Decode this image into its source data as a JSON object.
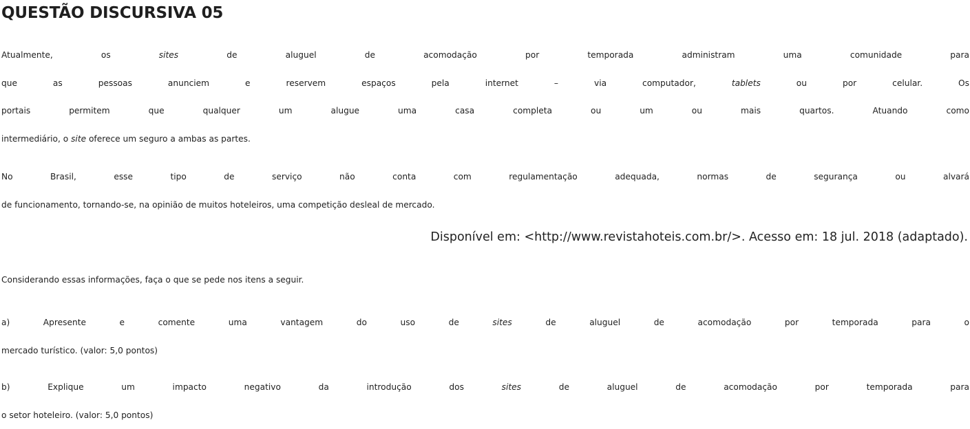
{
  "title": "QUESTÃO DISCURSIVA 05",
  "paragraph1": {
    "line1_a": "Atualmente, os ",
    "line1_b": "sites",
    "line1_c": " de aluguel de acomodação por temporada administram uma comunidade para",
    "line2_a": "que as pessoas anunciem e reservem espaços pela internet – via computador, ",
    "line2_b": "tablets",
    "line2_c": " ou por celular. Os",
    "line3": "portais permitem que qualquer um alugue uma casa completa ou um ou mais quartos. Atuando como",
    "line4_a": "intermediário, o ",
    "line4_b": "site",
    "line4_c": " oferece um seguro a ambas as partes."
  },
  "paragraph2": {
    "line1": "No Brasil, esse tipo de serviço não conta com regulamentação adequada, normas de segurança ou alvará",
    "line2": "de funcionamento, tornando-se, na opinião de muitos hoteleiros, uma competição desleal de mercado."
  },
  "citation": "Disponível em: <http://www.revistahoteis.com.br/>. Acesso em: 18 jul. 2018 (adaptado).",
  "instruction": "Considerando essas informações, faça o que se pede nos itens a seguir.",
  "item_a": {
    "line1_a": "a) Apresente e comente uma vantagem do uso de ",
    "line1_b": "sites",
    "line1_c": " de aluguel de acomodação por temporada para o",
    "line2": "mercado turístico. (valor: 5,0 pontos)"
  },
  "item_b": {
    "line1_a": "b) Explique um impacto negativo da introdução dos ",
    "line1_b": "sites",
    "line1_c": " de aluguel de acomodação por temporada para",
    "line2": "o setor hoteleiro. (valor: 5,0 pontos)"
  }
}
